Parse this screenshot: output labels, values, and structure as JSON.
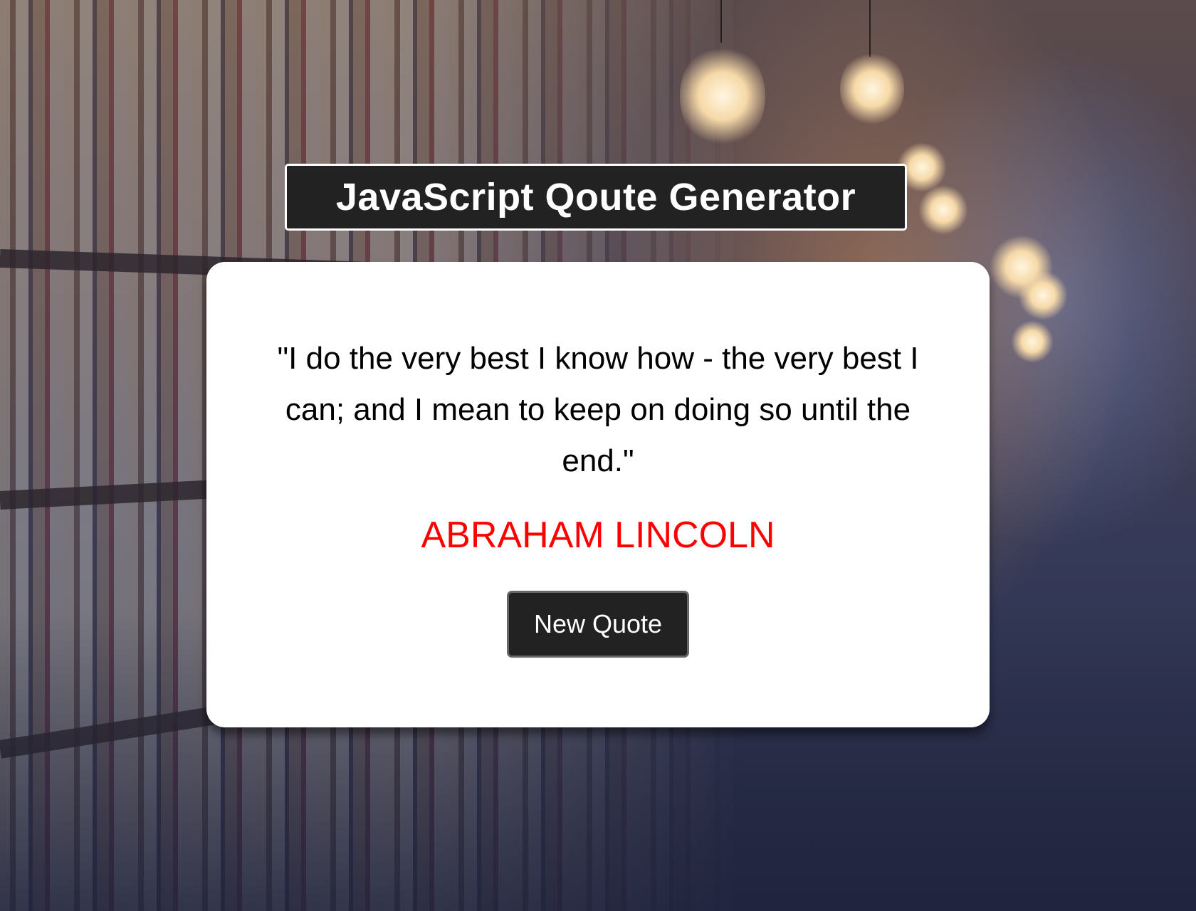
{
  "header": {
    "title": "JavaScript Qoute Generator"
  },
  "quote": {
    "text": "\"I do the very best I know how - the very best I can; and I mean to keep on doing so until the end.\"",
    "author": "ABRAHAM LINCOLN",
    "author_color": "#ff0000"
  },
  "actions": {
    "new_quote_label": "New Quote"
  },
  "colors": {
    "title_background": "#222222",
    "button_background": "#222222",
    "card_background": "#ffffff"
  }
}
